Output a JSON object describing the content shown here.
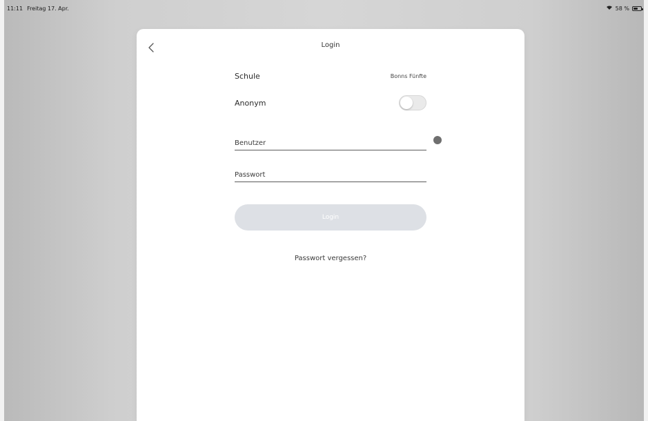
{
  "status_bar": {
    "time": "11:11",
    "date": "Freitag 17. Apr.",
    "battery": "58 %"
  },
  "modal": {
    "title": "Login",
    "back_icon": "chevron-left-icon"
  },
  "school": {
    "label": "Schule",
    "value": "Bonns Fünfte"
  },
  "anonymous": {
    "label": "Anonym",
    "enabled": false
  },
  "username": {
    "placeholder": "Benutzer",
    "value": ""
  },
  "password": {
    "placeholder": "Passwort",
    "value": ""
  },
  "login_button": {
    "label": "Login",
    "background": "#dde0e5"
  },
  "forgot_password": {
    "label": "Passwort vergessen?"
  }
}
